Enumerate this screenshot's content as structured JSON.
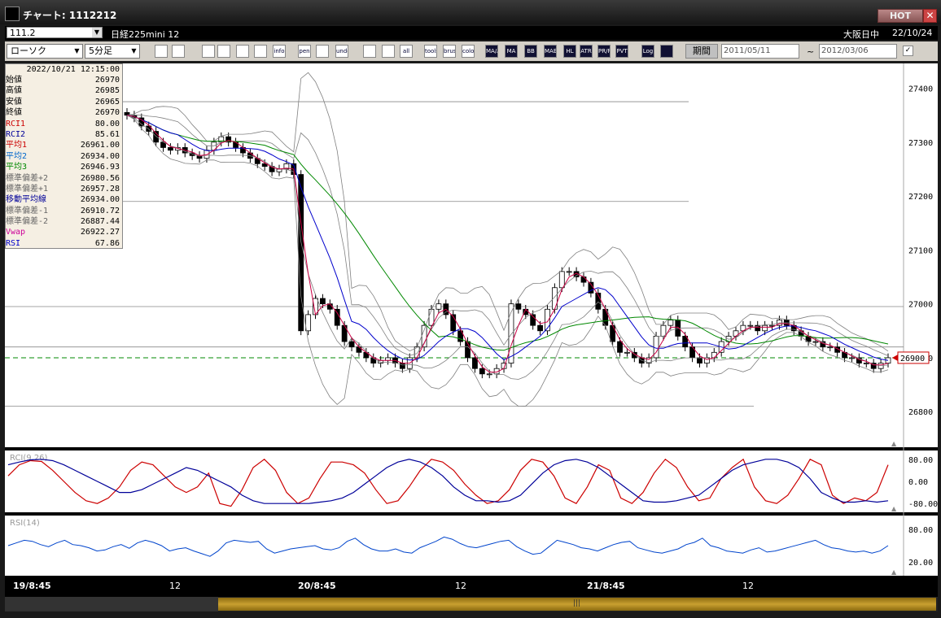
{
  "window": {
    "title": "チャート: 1112212",
    "hot_label": "HOT",
    "close_label": "✕"
  },
  "infobar": {
    "symbol_code": "111.2",
    "symbol_name": "日経225mini 12",
    "market": "大阪日中",
    "date": "22/10/24"
  },
  "toolbar": {
    "chart_type": "ローソク",
    "interval": "5分足",
    "buttons": [
      "zoom-search",
      "split-window",
      "draw-trend",
      "search-chart",
      "bar-chart",
      "compare",
      "info",
      "pen",
      "cursor",
      "undo",
      "candle-up",
      "candle-down",
      "all",
      "tools",
      "brush",
      "color",
      "MA/AB",
      "MA",
      "BB",
      "MAE",
      "HL",
      "ATR",
      "PR/RA",
      "PVT",
      "Log",
      "export"
    ],
    "period_label": "期間",
    "date_from": "2011/05/11",
    "date_to": "2012/03/06",
    "tilde": "~"
  },
  "infobox": {
    "timestamp": "2022/10/21  12:15:00",
    "rows": [
      {
        "label": "始値",
        "value": "26970",
        "color": "#000000"
      },
      {
        "label": "高値",
        "value": "26985",
        "color": "#000000"
      },
      {
        "label": "安値",
        "value": "26965",
        "color": "#000000"
      },
      {
        "label": "終値",
        "value": "26970",
        "color": "#000000"
      },
      {
        "label": "RCI1",
        "value": "80.00",
        "color": "#cc0000"
      },
      {
        "label": "RCI2",
        "value": "85.61",
        "color": "#000099"
      },
      {
        "label": "平均1",
        "value": "26961.00",
        "color": "#cc0000"
      },
      {
        "label": "平均2",
        "value": "26934.00",
        "color": "#0066cc"
      },
      {
        "label": "平均3",
        "value": "26946.93",
        "color": "#008800"
      },
      {
        "label": "標準偏差+2",
        "value": "26980.56",
        "color": "#666666"
      },
      {
        "label": "標準偏差+1",
        "value": "26957.28",
        "color": "#666666"
      },
      {
        "label": "移動平均線",
        "value": "26934.00",
        "color": "#000099"
      },
      {
        "label": "標準偏差-1",
        "value": "26910.72",
        "color": "#666666"
      },
      {
        "label": "標準偏差-2",
        "value": "26887.44",
        "color": "#666666"
      },
      {
        "label": "Vwap",
        "value": "26922.27",
        "color": "#cc0099"
      },
      {
        "label": "RSI",
        "value": "67.86",
        "color": "#0000cc"
      }
    ]
  },
  "chart_data": {
    "type": "candlestick",
    "y_ticks": [
      27400,
      27300,
      27200,
      27100,
      27000,
      26900,
      26800
    ],
    "ylim": [
      26740,
      27440
    ],
    "x_ticks": [
      "19/8:45",
      "12",
      "20/8:45",
      "12",
      "21/8:45",
      "12"
    ],
    "current_price": "26900",
    "price_markers": [
      26900
    ],
    "horizontal_lines": [
      27375,
      27190,
      26995,
      26920,
      26810
    ],
    "series": {
      "close": [
        27350,
        27345,
        27330,
        27320,
        27300,
        27290,
        27285,
        27290,
        27280,
        27275,
        27270,
        27285,
        27300,
        27310,
        27300,
        27290,
        27280,
        27270,
        27260,
        27255,
        27245,
        27250,
        27260,
        27240,
        26950,
        26980,
        27010,
        27000,
        26990,
        26960,
        26930,
        26920,
        26910,
        26900,
        26890,
        26895,
        26900,
        26890,
        26880,
        26900,
        26920,
        26960,
        26990,
        27000,
        26980,
        26950,
        26930,
        26900,
        26880,
        26870,
        26870,
        26880,
        26890,
        27000,
        26990,
        26980,
        26960,
        26950,
        26990,
        27030,
        27060,
        27060,
        27050,
        27040,
        27020,
        26990,
        26960,
        26930,
        26910,
        26910,
        26900,
        26890,
        26900,
        26940,
        26960,
        26970,
        26940,
        26920,
        26900,
        26890,
        26900,
        26910,
        26930,
        26940,
        26950,
        26960,
        26960,
        26950,
        26960,
        26960,
        26970,
        26960,
        26950,
        26940,
        26930,
        26930,
        26920,
        26920,
        26910,
        26900,
        26900,
        26890,
        26890,
        26880,
        26890,
        26900
      ],
      "rci": [
        {
          "name": "RCI(9",
          "values": [
            20,
            60,
            75,
            72,
            40,
            0,
            -40,
            -70,
            -80,
            -60,
            -20,
            40,
            70,
            60,
            20,
            -20,
            -40,
            -20,
            30,
            -80,
            -90,
            -30,
            50,
            80,
            40,
            -40,
            -80,
            -60,
            10,
            70,
            70,
            60,
            30,
            -30,
            -80,
            -70,
            -20,
            40,
            80,
            70,
            40,
            -10,
            -50,
            -80,
            -70,
            -30,
            40,
            80,
            70,
            20,
            -60,
            -80,
            -20,
            60,
            40,
            -60,
            -80,
            -40,
            30,
            80,
            50,
            -20,
            -70,
            -60,
            10,
            50,
            80,
            -20,
            -70,
            -80,
            -50,
            10,
            80,
            60,
            -50,
            -80,
            -60,
            -70,
            -40,
            60
          ]
        },
        {
          "name": "26)",
          "values": [
            60,
            70,
            78,
            80,
            75,
            60,
            40,
            20,
            0,
            -20,
            -40,
            -40,
            -30,
            -10,
            10,
            30,
            50,
            40,
            20,
            0,
            -20,
            -50,
            -70,
            -80,
            -80,
            -80,
            -80,
            -80,
            -75,
            -70,
            -60,
            -40,
            -10,
            20,
            50,
            70,
            80,
            70,
            50,
            20,
            -20,
            -50,
            -70,
            -70,
            -75,
            -70,
            -50,
            -10,
            30,
            60,
            75,
            80,
            70,
            50,
            20,
            -10,
            -40,
            -70,
            -75,
            -75,
            -70,
            -60,
            -50,
            -20,
            10,
            40,
            60,
            70,
            80,
            80,
            70,
            50,
            10,
            -40,
            -60,
            -75,
            -75,
            -70,
            -75,
            -70
          ]
        }
      ],
      "rsi": [
        50,
        55,
        60,
        58,
        52,
        48,
        55,
        60,
        52,
        50,
        46,
        40,
        42,
        48,
        52,
        45,
        55,
        60,
        56,
        50,
        40,
        44,
        46,
        40,
        35,
        30,
        40,
        55,
        60,
        58,
        56,
        58,
        44,
        36,
        40,
        44,
        46,
        48,
        50,
        44,
        42,
        46,
        58,
        64,
        52,
        44,
        40,
        40,
        44,
        38,
        36,
        46,
        52,
        58,
        66,
        62,
        54,
        48,
        46,
        50,
        54,
        58,
        60,
        48,
        40,
        34,
        36,
        48,
        60,
        56,
        52,
        46,
        44,
        40,
        46,
        52,
        56,
        58,
        46,
        42,
        38,
        36,
        40,
        44,
        52,
        56,
        64,
        50,
        46,
        40,
        38,
        36,
        42,
        46,
        38,
        40,
        44,
        48,
        52,
        56,
        60,
        52,
        46,
        44,
        40,
        38,
        40,
        36,
        40,
        50
      ]
    },
    "rci_label": "RCI(9,26)",
    "rci_ticks": [
      "80.00",
      "0.00",
      "-80.00"
    ],
    "rsi_label": "RSI(14)",
    "rsi_ticks": [
      "80.00",
      "20.00"
    ],
    "colors": {
      "up": "#ffffff",
      "down": "#000000",
      "ma1": "#cc0044",
      "ma2": "#0000cc",
      "ma3": "#008800",
      "bb": "#808080",
      "rci1": "#cc0000",
      "rci2": "#000099",
      "rsi": "#0044cc",
      "marker": "#cc0000",
      "dashed": "#008800"
    }
  }
}
